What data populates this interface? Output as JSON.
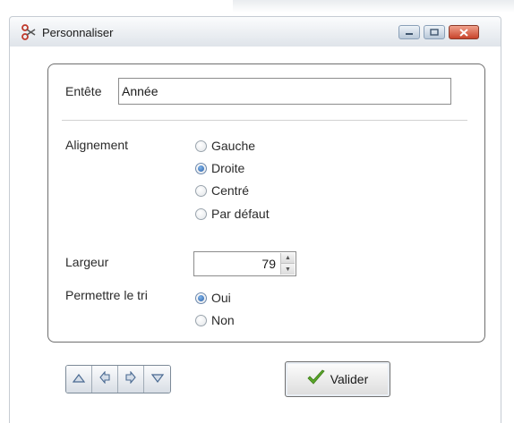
{
  "window": {
    "title": "Personnaliser"
  },
  "form": {
    "header_label": "Entête",
    "header_value": "Année",
    "alignment_label": "Alignement",
    "alignment_options": [
      {
        "label": "Gauche",
        "checked": false
      },
      {
        "label": "Droite",
        "checked": true
      },
      {
        "label": "Centré",
        "checked": false
      },
      {
        "label": "Par défaut",
        "checked": false
      }
    ],
    "width_label": "Largeur",
    "width_value": "79",
    "sort_label": "Permettre le tri",
    "sort_options": [
      {
        "label": "Oui",
        "checked": true
      },
      {
        "label": "Non",
        "checked": false
      }
    ]
  },
  "buttons": {
    "validate_label": "Valider"
  },
  "icons": {
    "app": "scissors-icon",
    "check": "checkmark-icon",
    "up": "triangle-up-icon",
    "left": "arrow-left-icon",
    "right": "arrow-right-icon",
    "down": "triangle-down-icon"
  },
  "colors": {
    "accent": "#2a5fa8",
    "checkmark": "#5aa82a",
    "close": "#c8432a"
  }
}
